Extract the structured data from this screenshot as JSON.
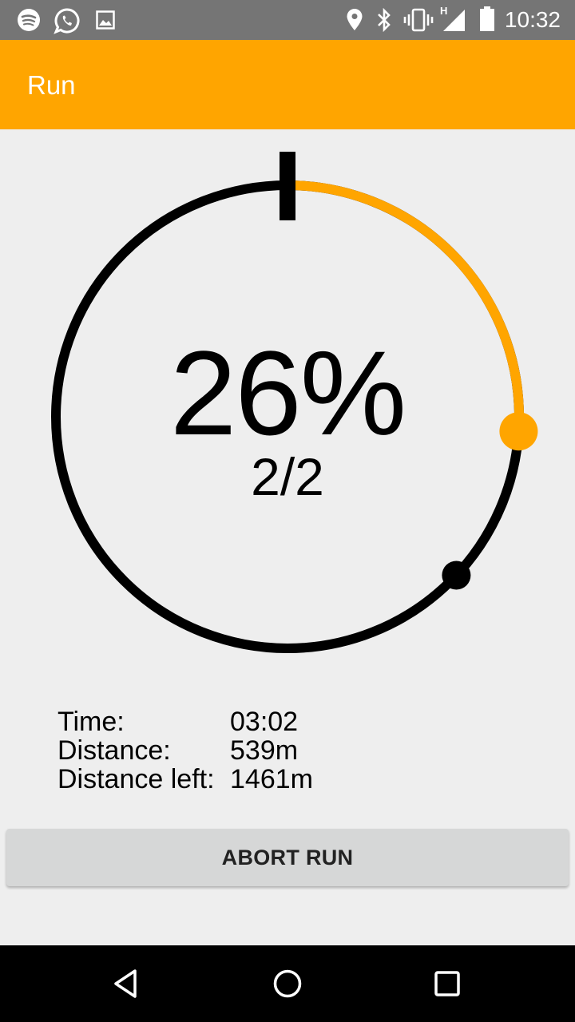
{
  "status_bar": {
    "time": "10:32",
    "network_type": "H",
    "left_icons": [
      "spotify-icon",
      "whatsapp-icon",
      "gallery-icon"
    ],
    "right_icons": [
      "location-icon",
      "bluetooth-icon",
      "vibrate-icon",
      "signal-icon",
      "battery-icon"
    ]
  },
  "app_bar": {
    "title": "Run"
  },
  "progress": {
    "percent_label": "26%",
    "percent_value": 26,
    "lap_label": "2/2",
    "lap_marker_fraction": 0.37,
    "colors": {
      "progress": "#ffa500",
      "track": "#000000"
    }
  },
  "stats": [
    {
      "label": "Time:",
      "value": "03:02"
    },
    {
      "label": "Distance:",
      "value": "539m"
    },
    {
      "label": "Distance left:",
      "value": "1461m"
    }
  ],
  "abort_button": {
    "label": "ABORT RUN"
  },
  "nav_bar": {
    "buttons": [
      "back-icon",
      "home-icon",
      "recents-icon"
    ]
  },
  "colors": {
    "accent": "#ffa500",
    "background": "#eeeeee",
    "status_bar": "#757575",
    "button": "#d6d7d7"
  }
}
